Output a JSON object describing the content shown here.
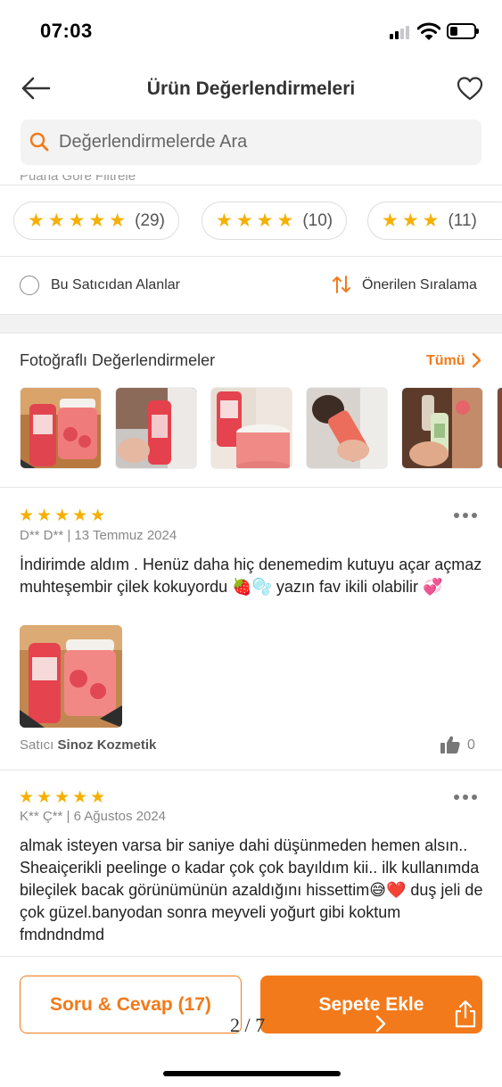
{
  "status_bar": {
    "time": "07:03"
  },
  "header": {
    "title": "Ürün Değerlendirmeleri"
  },
  "search": {
    "placeholder": "Değerlendirmelerde Ara"
  },
  "filters": {
    "partial_label": "Puana Göre Filtrele",
    "chips": [
      {
        "stars": "★★★★★",
        "count": "(29)"
      },
      {
        "stars": "★★★★",
        "count": "(10)"
      },
      {
        "stars": "★★★",
        "count": "(11)"
      }
    ]
  },
  "options": {
    "seller_filter_label": "Bu Satıcıdan Alanlar",
    "sort_label": "Önerilen Sıralama"
  },
  "photo_reviews": {
    "title": "Fotoğraflı Değerlendirmeler",
    "all_label": "Tümü"
  },
  "reviews": [
    {
      "stars": "★★★★★",
      "meta": "D** D** | 13 Temmuz 2024",
      "text": "İndirimde aldım . Henüz daha hiç denemedim kutuyu açar açmaz muhteşembir çilek kokuyordu 🍓🫧 yazın fav ikili olabilir 💞",
      "seller_prefix": "Satıcı",
      "seller_name": "Sinoz Kozmetik",
      "likes": "0"
    },
    {
      "stars": "★★★★★",
      "meta": "K** Ç** | 6 Ağustos 2024",
      "text": "almak isteyen varsa bir saniye dahi düşünmeden hemen alsın.. Sheaiçerikli peelinge o kadar çok çok bayıldım kii.. ilk kullanımda bileçilek bacak görünümünün azaldığını hissettim😅❤️ duş jeli de çok güzel.banyodan sonra meyveli yoğurt gibi koktum fmdndndmd"
    }
  ],
  "bottom": {
    "qa_label": "Soru & Cevap (17)",
    "cart_label": "Sepete Ekle",
    "page_indicator": "2 / 7"
  },
  "colors": {
    "accent": "#f27a1a",
    "star": "#f5b000"
  }
}
